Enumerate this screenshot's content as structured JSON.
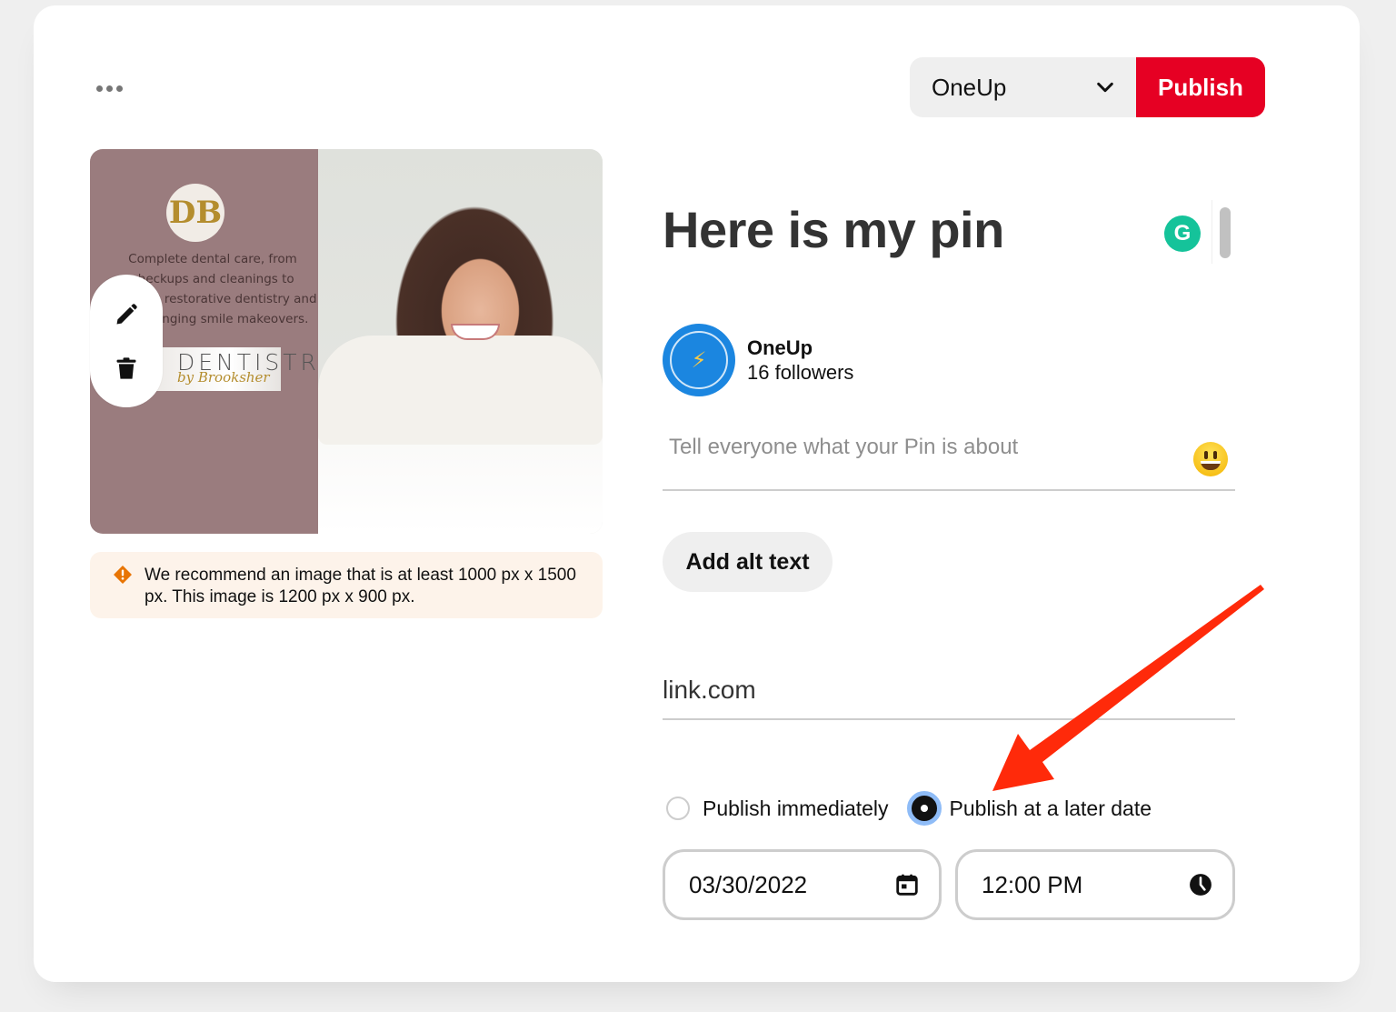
{
  "header": {
    "more_icon": "ellipsis-icon",
    "board_select": {
      "selected": "OneUp",
      "icon": "chevron-down-icon"
    },
    "publish_label": "Publish"
  },
  "image_preview": {
    "overlay": {
      "logo_letters": "DB",
      "tagline": "Complete dental care, from checkups and cleanings to complex restorative dentistry and life-changing smile makeovers.",
      "brand_name": "DENTISTRY",
      "brand_sub": "by Brooksher"
    },
    "actions": [
      {
        "name": "edit",
        "icon": "pencil-icon"
      },
      {
        "name": "delete",
        "icon": "trash-icon"
      }
    ]
  },
  "warning": {
    "icon": "warning-diamond-icon",
    "text": "We recommend an image that is at least 1000 px x 1500 px. This image is 1200 px x 900 px."
  },
  "pin": {
    "title": "Here is my pin",
    "grammarly_label": "G"
  },
  "account": {
    "name": "OneUp",
    "followers": "16 followers"
  },
  "description": {
    "value": "",
    "placeholder": "Tell everyone what your Pin is about",
    "emoji_icon": "smiley-emoji-icon"
  },
  "alt_text_button": "Add alt text",
  "link": {
    "value": "link.com"
  },
  "schedule": {
    "options": [
      {
        "label": "Publish immediately",
        "checked": false
      },
      {
        "label": "Publish at a later date",
        "checked": true
      }
    ],
    "date": "03/30/2022",
    "time": "12:00 PM"
  },
  "colors": {
    "publish_red": "#e60023",
    "warning_bg": "#fdf3ea",
    "warning_icon": "#e87504",
    "grammarly_green": "#15c39a",
    "radio_focus": "#8fbcf7",
    "annotation_arrow": "#ff2a0a"
  }
}
